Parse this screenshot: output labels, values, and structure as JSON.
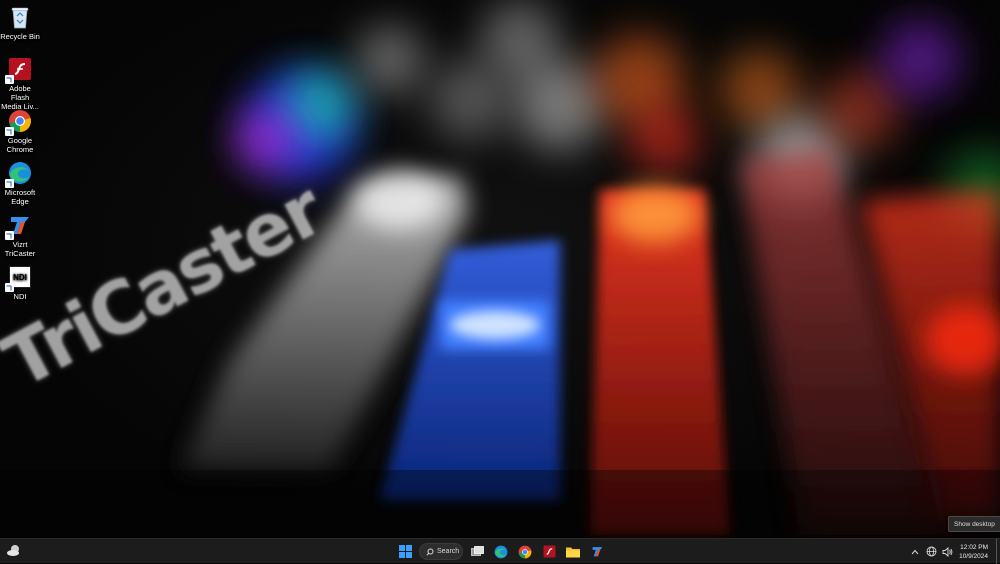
{
  "desktop": {
    "icons": [
      {
        "label": "Recycle Bin",
        "icon": "recycle-bin-icon"
      },
      {
        "label": "Adobe Flash Media Liv...",
        "icon": "adobe-flash-icon"
      },
      {
        "label": "Google Chrome",
        "icon": "chrome-icon"
      },
      {
        "label": "Microsoft Edge",
        "icon": "edge-icon"
      },
      {
        "label": "Vizrt TriCaster",
        "icon": "tricaster-icon"
      },
      {
        "label": "NDI",
        "icon": "ndi-icon",
        "glyph_text": "NDI"
      }
    ]
  },
  "taskbar": {
    "search_label": "Search",
    "pinned": [
      "start-icon",
      "search",
      "task-view-icon",
      "edge-icon",
      "chrome-icon",
      "adobe-flash-icon",
      "file-explorer-icon",
      "tricaster-icon"
    ],
    "clock_time": "12:02 PM",
    "clock_date": "10/9/2024",
    "tooltip": "Show desktop"
  },
  "colors": {
    "taskbar_bg": "#1c1c1c",
    "windows_blue": "#2f8cff",
    "flash_red": "#c21f2c"
  }
}
